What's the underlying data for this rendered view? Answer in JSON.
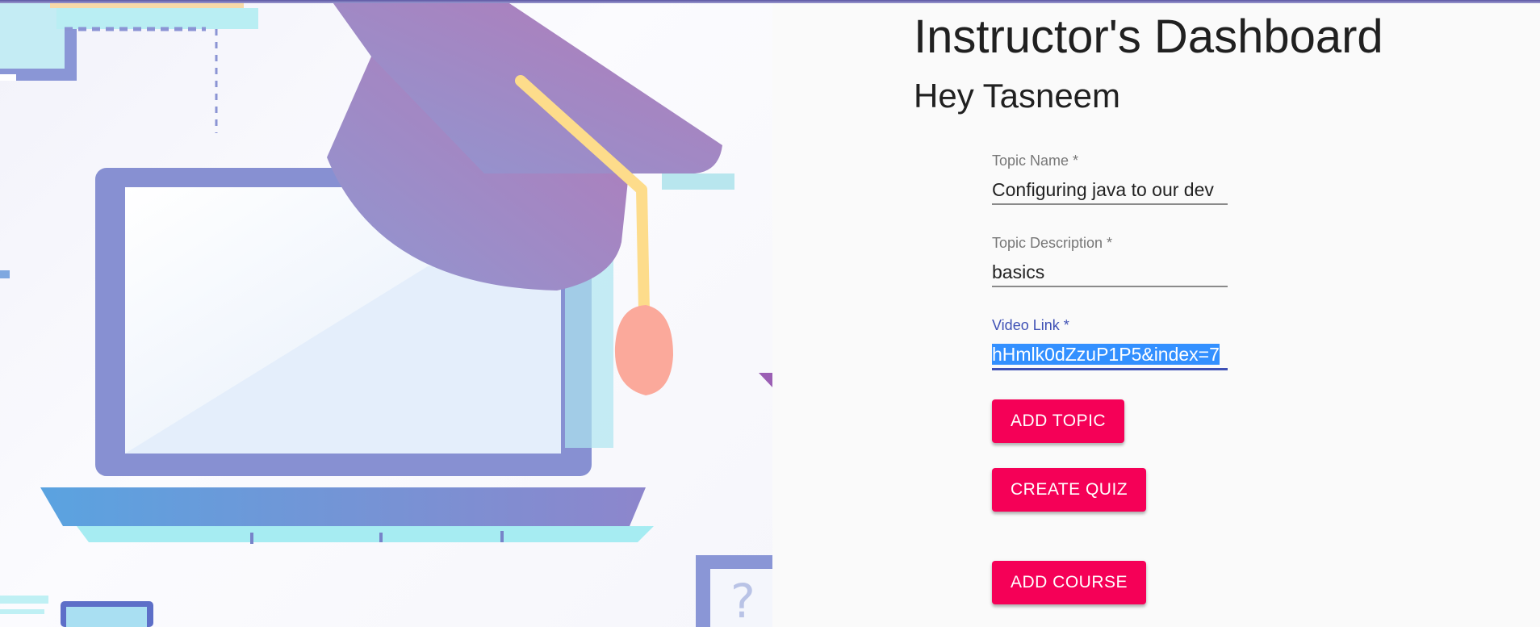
{
  "header": {
    "title": "Instructor's Dashboard",
    "greeting": "Hey Tasneem"
  },
  "form": {
    "topic_name": {
      "label": "Topic Name *",
      "value": "Configuring java to our dev"
    },
    "topic_description": {
      "label": "Topic Description *",
      "value": "basics"
    },
    "video_link": {
      "label": "Video Link *",
      "value": "hHmlk0dZzuP1P5&index=7"
    }
  },
  "buttons": {
    "add_topic": "ADD TOPIC",
    "create_quiz": "CREATE QUIZ",
    "add_course": "ADD COURSE"
  },
  "illustration": {
    "icon": "graduation-laptop-illustration",
    "question_mark": "?"
  },
  "colors": {
    "accent_button": "#f50057",
    "focus": "#3f51b5",
    "selection": "#3390ff",
    "topbar": "#5c57a4"
  }
}
